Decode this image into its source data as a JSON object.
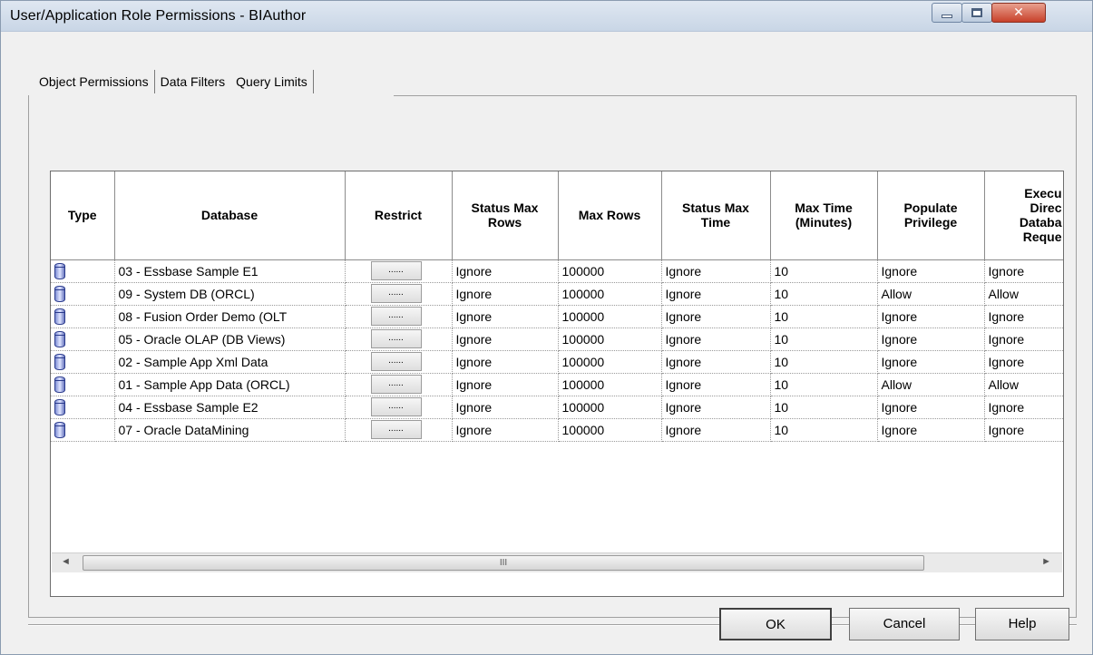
{
  "window": {
    "title": "User/Application Role Permissions - BIAuthor"
  },
  "tabs": [
    {
      "label": "Object Permissions"
    },
    {
      "label": "Data Filters"
    },
    {
      "label": "Query Limits"
    }
  ],
  "grid": {
    "columns": [
      "Type",
      "Database",
      "Restrict",
      "Status Max Rows",
      "Max Rows",
      "Status Max Time",
      "Max Time (Minutes)",
      "Populate Privilege",
      "Execute Direct Database Requests"
    ],
    "columns_visible": [
      "Type",
      "Database",
      "Restrict",
      "Status Max\nRows",
      "Max Rows",
      "Status Max\nTime",
      "Max Time\n(Minutes)",
      "Populate\nPrivilege",
      "Execu\nDirec\nDataba\nReque"
    ],
    "restrict_button": "......",
    "rows": [
      {
        "database": "03 - Essbase Sample E1",
        "status_max_rows": "Ignore",
        "max_rows": "100000",
        "status_max_time": "Ignore",
        "max_time": "10",
        "populate_privilege": "Ignore",
        "execute_direct": "Ignore"
      },
      {
        "database": "09 - System DB (ORCL)",
        "status_max_rows": "Ignore",
        "max_rows": "100000",
        "status_max_time": "Ignore",
        "max_time": "10",
        "populate_privilege": "Allow",
        "execute_direct": "Allow"
      },
      {
        "database": "08 - Fusion Order Demo (OLT",
        "status_max_rows": "Ignore",
        "max_rows": "100000",
        "status_max_time": "Ignore",
        "max_time": "10",
        "populate_privilege": "Ignore",
        "execute_direct": "Ignore"
      },
      {
        "database": "05 - Oracle OLAP (DB Views)",
        "status_max_rows": "Ignore",
        "max_rows": "100000",
        "status_max_time": "Ignore",
        "max_time": "10",
        "populate_privilege": "Ignore",
        "execute_direct": "Ignore"
      },
      {
        "database": "02 - Sample App Xml Data",
        "status_max_rows": "Ignore",
        "max_rows": "100000",
        "status_max_time": "Ignore",
        "max_time": "10",
        "populate_privilege": "Ignore",
        "execute_direct": "Ignore"
      },
      {
        "database": "01 - Sample App Data (ORCL)",
        "status_max_rows": "Ignore",
        "max_rows": "100000",
        "status_max_time": "Ignore",
        "max_time": "10",
        "populate_privilege": "Allow",
        "execute_direct": "Allow"
      },
      {
        "database": "04 - Essbase Sample E2",
        "status_max_rows": "Ignore",
        "max_rows": "100000",
        "status_max_time": "Ignore",
        "max_time": "10",
        "populate_privilege": "Ignore",
        "execute_direct": "Ignore"
      },
      {
        "database": "07 - Oracle DataMining",
        "status_max_rows": "Ignore",
        "max_rows": "100000",
        "status_max_time": "Ignore",
        "max_time": "10",
        "populate_privilege": "Ignore",
        "execute_direct": "Ignore"
      }
    ]
  },
  "scrollbar": {
    "thumb_grip": "III"
  },
  "buttons": {
    "ok": "OK",
    "cancel": "Cancel",
    "help": "Help"
  }
}
